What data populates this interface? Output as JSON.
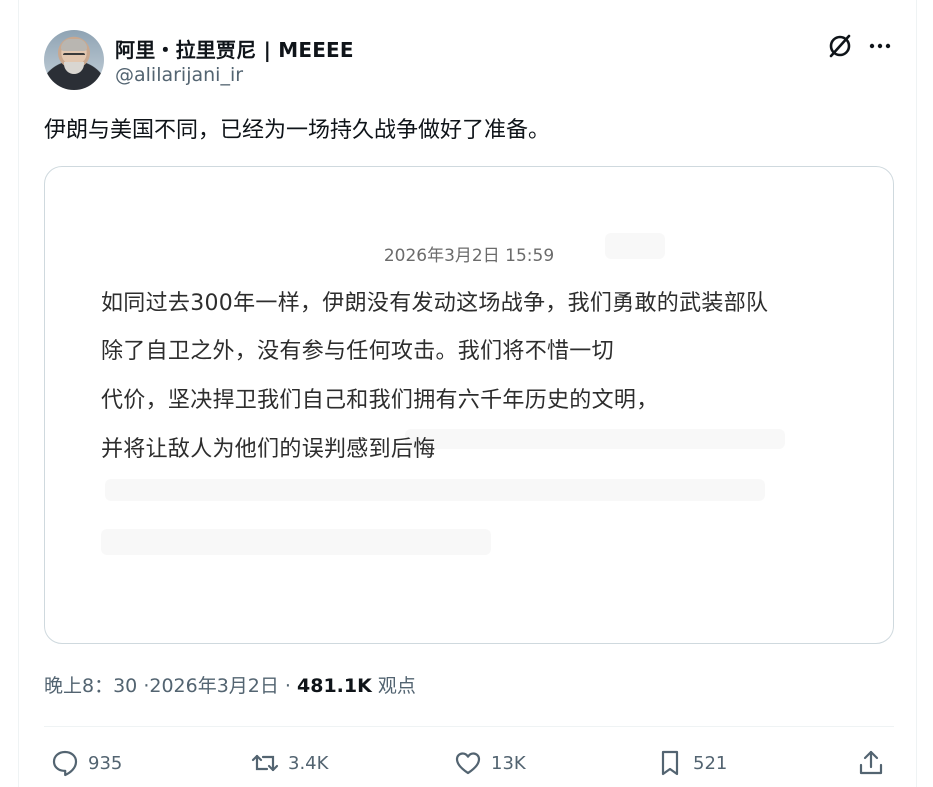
{
  "author": {
    "display_name": "阿里・拉里贾尼 | MEEEE",
    "handle": "@alilarijani_ir"
  },
  "tweet": {
    "text": "伊朗与美国不同，已经为一场持久战争做好了准备。"
  },
  "card": {
    "date": "2026年3月2日 15:59",
    "lines": [
      "如同过去300年一样，伊朗没有发动这场战争，我们勇敢的武装部队",
      "除了自卫之外，没有参与任何攻击。我们将不惜一切",
      "代价，坚决捍卫我们自己和我们拥有六千年历史的文明，",
      "并将让敌人为他们的误判感到后悔"
    ]
  },
  "meta": {
    "time": "晚上8：30",
    "date": "·2026年3月2日 ·",
    "views_count": "481.1K",
    "views_label": "观点"
  },
  "actions": {
    "replies": "935",
    "reposts": "3.4K",
    "likes": "13K",
    "bookmarks": "521"
  },
  "icons": {
    "grok": "grok-icon",
    "more": "more-icon",
    "reply": "reply-icon",
    "repost": "repost-icon",
    "like": "heart-icon",
    "bookmark": "bookmark-icon",
    "share": "share-icon"
  },
  "colors": {
    "text": "#0f1419",
    "secondary": "#536471",
    "border": "#cfd9de"
  }
}
